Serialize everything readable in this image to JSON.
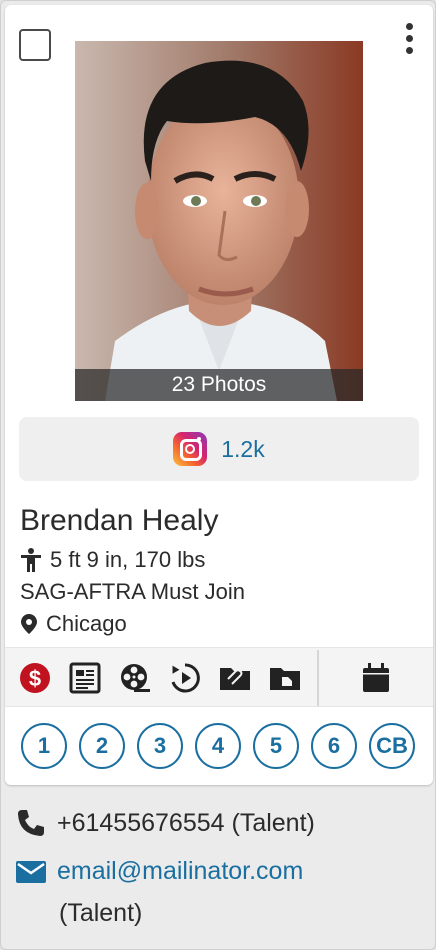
{
  "photo": {
    "caption": "23 Photos"
  },
  "social": {
    "instagram_count": "1.2k"
  },
  "talent": {
    "name": "Brendan Healy",
    "stats": "5 ft 9 in, 170 lbs",
    "union": "SAG-AFTRA Must Join",
    "location": "Chicago"
  },
  "toolbar": {
    "icons": [
      "dollar-icon",
      "resume-icon",
      "film-reel-icon",
      "replay-icon",
      "attachment-folder-icon",
      "folder-icon",
      "calendar-icon"
    ],
    "accent": "#c0121f"
  },
  "circles": [
    "1",
    "2",
    "3",
    "4",
    "5",
    "6",
    "CB"
  ],
  "contact": {
    "phone": "+61455676554 (Talent)",
    "email": "email@mailinator.com",
    "email_note": "(Talent)"
  },
  "colors": {
    "link": "#1a6fa0",
    "text": "#2b2b2b"
  }
}
